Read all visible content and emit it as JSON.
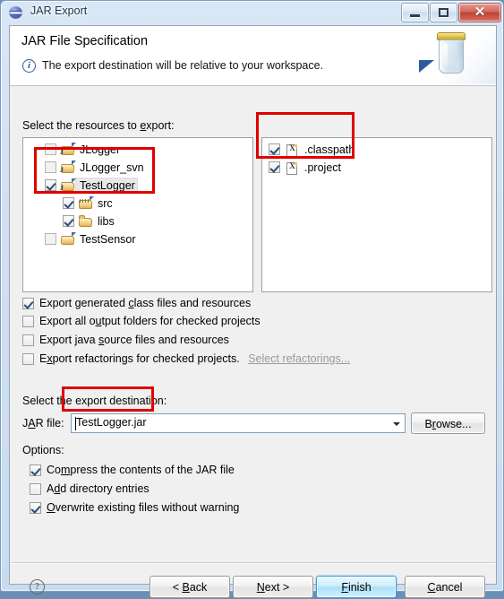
{
  "window": {
    "title": "JAR Export",
    "icon": "jar-export-globe-icon",
    "buttons": {
      "minimize": "minimize",
      "maximize": "maximize",
      "close": "✕"
    }
  },
  "header": {
    "title": "JAR File Specification",
    "message": "The export destination will be relative to your workspace.",
    "info_icon": "i",
    "art_icon": "jar-graphic"
  },
  "resources": {
    "label_pre": "Select the resources to ",
    "label_mnemonic": "e",
    "label_post": "xport:",
    "tree": [
      {
        "name": "JLogger",
        "checked": false,
        "indent": 0,
        "icon": "java-project-icon"
      },
      {
        "name": "JLogger_svn",
        "checked": false,
        "indent": 0,
        "icon": "java-project-icon"
      },
      {
        "name": "TestLogger",
        "checked": true,
        "indent": 0,
        "icon": "java-project-icon",
        "selected": true
      },
      {
        "name": "src",
        "checked": true,
        "indent": 1,
        "icon": "source-package-icon"
      },
      {
        "name": "libs",
        "checked": true,
        "indent": 1,
        "icon": "folder-icon"
      },
      {
        "name": "TestSensor",
        "checked": false,
        "indent": 0,
        "icon": "project-icon"
      }
    ],
    "files": [
      {
        "name": ".classpath",
        "checked": true,
        "icon": "xml-file-icon",
        "glyph": "X"
      },
      {
        "name": ".project",
        "checked": true,
        "icon": "xml-file-icon",
        "glyph": "X"
      }
    ]
  },
  "export_options": [
    {
      "pre": "Export generated ",
      "mnemonic": "c",
      "post": "lass files and resources",
      "checked": true
    },
    {
      "pre": "Export all o",
      "mnemonic": "u",
      "post": "tput folders for checked projects",
      "checked": false
    },
    {
      "pre": "Export java ",
      "mnemonic": "s",
      "post": "ource files and resources",
      "checked": false
    },
    {
      "pre": "E",
      "mnemonic": "x",
      "post": "port refactorings for checked projects.",
      "checked": false,
      "link": "Select refactorings..."
    }
  ],
  "destination": {
    "section_label": "Select the export destination:",
    "field_label_pre": "J",
    "field_label_mnemonic": "A",
    "field_label_post": "R file:",
    "jar_file_value": "TestLogger.jar",
    "jar_file_placeholder": "",
    "browse_pre": "B",
    "browse_mnemonic": "r",
    "browse_post": "owse..."
  },
  "options": {
    "label": "Options:",
    "items": [
      {
        "pre": "Co",
        "mnemonic": "m",
        "post": "press the contents of the JAR file",
        "checked": true
      },
      {
        "pre": "A",
        "mnemonic": "d",
        "post": "d directory entries",
        "checked": false
      },
      {
        "pre": "",
        "mnemonic": "O",
        "post": "verwrite existing files without warning",
        "checked": true
      }
    ]
  },
  "footer": {
    "help": "?",
    "back_pre": "< ",
    "back_mnemonic": "B",
    "back_post": "ack",
    "next_pre": "",
    "next_mnemonic": "N",
    "next_post": "ext >",
    "finish_pre": "",
    "finish_mnemonic": "F",
    "finish_post": "inish",
    "cancel_pre": "",
    "cancel_mnemonic": "C",
    "cancel_post": "ancel"
  },
  "annotations": {
    "colors": {
      "highlight": "#e00000",
      "default_button": "#2f9fd4"
    },
    "boxes": [
      "tree-testlogger-group",
      "file-list-items",
      "jar-file-input"
    ]
  }
}
